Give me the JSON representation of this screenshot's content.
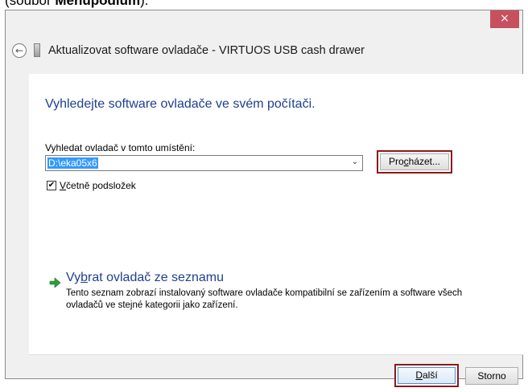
{
  "doc_snippet": {
    "text": "(soubor ",
    "bold": "Menupodium",
    "end": ")."
  },
  "window": {
    "close_glyph": "×",
    "title": "Aktualizovat software ovladače - VIRTUOS USB cash drawer",
    "icons": {
      "back": "back-arrow-icon",
      "device": "usb-device-icon"
    }
  },
  "content": {
    "title": "Vyhledejte software ovladače ve svém počítači.",
    "search_label": "Vyhledat ovladač v tomto umístění:",
    "path_value": "D:\\eka05x6",
    "browse": {
      "pre": "Pro",
      "accel": "c",
      "post": "házet..."
    },
    "include_subfolders": {
      "checked": true,
      "accel": "V",
      "rest": "četně podsložek"
    },
    "pick_from_list": {
      "pre": "Vy",
      "accel": "b",
      "post": "rat ovladač ze seznamu",
      "description": "Tento seznam zobrazí instalovaný software ovladače kompatibilní se zařízením a software všech ovladačů ve stejné kategorii jako zařízení."
    }
  },
  "footer": {
    "next": {
      "accel": "D",
      "rest": "alší"
    },
    "cancel": "Storno"
  },
  "colors": {
    "accent_blue": "#1f3f8f",
    "highlight_red": "#8b1a1a",
    "close_red": "#c7505e",
    "selection": "#3399ff",
    "arrow_green": "#2e9e3a"
  }
}
